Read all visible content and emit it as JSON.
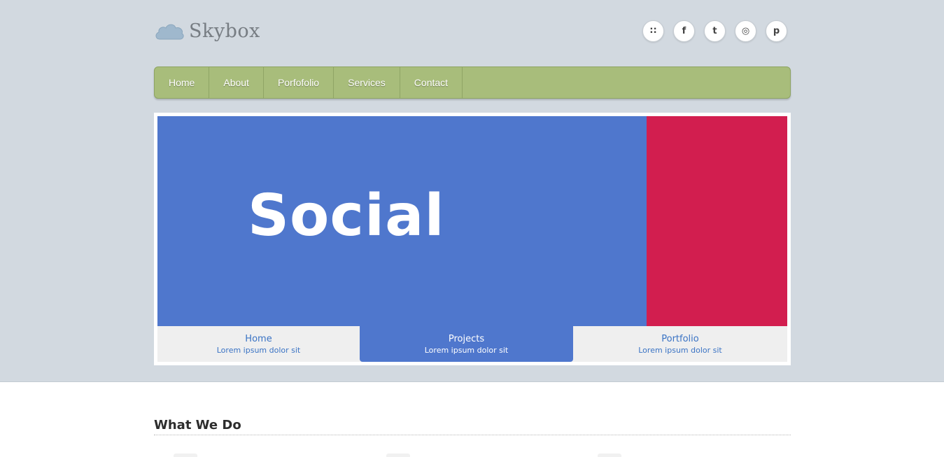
{
  "brand": {
    "name": "Skybox",
    "logo_icon": "cloud-icon"
  },
  "social": [
    {
      "icon": "rss-icon",
      "glyph": "∷"
    },
    {
      "icon": "facebook-icon",
      "glyph": "f"
    },
    {
      "icon": "twitter-icon",
      "glyph": "t"
    },
    {
      "icon": "dribbble-icon",
      "glyph": "◎"
    },
    {
      "icon": "pinterest-icon",
      "glyph": "p"
    }
  ],
  "nav": {
    "items": [
      "Home",
      "About",
      "Porfofolio",
      "Services",
      "Contact"
    ]
  },
  "slider": {
    "title": "Social",
    "colors": {
      "main": "#4f77cd",
      "side": "#d21e4f"
    },
    "tabs": [
      {
        "title": "Home",
        "subtitle": "Lorem ipsum dolor sit",
        "active": false
      },
      {
        "title": "Projects",
        "subtitle": "Lorem ipsum dolor sit",
        "active": true
      },
      {
        "title": "Portfolio",
        "subtitle": "Lorem ipsum dolor sit",
        "active": false
      }
    ]
  },
  "section": {
    "title": "What We Do"
  },
  "colors": {
    "background": "#d2d9e0",
    "nav": "#a8bd7b",
    "accent": "#3a73c4"
  }
}
